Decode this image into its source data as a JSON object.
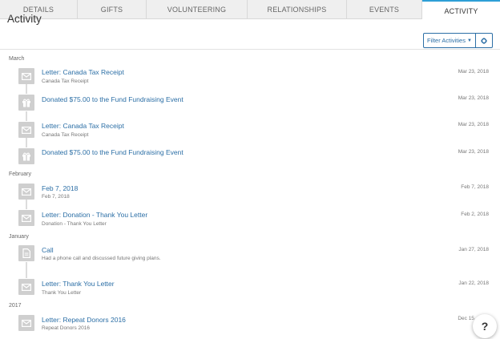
{
  "tabs": [
    {
      "label": "DETAILS"
    },
    {
      "label": "GIFTS"
    },
    {
      "label": "VOLUNTEERING"
    },
    {
      "label": "RELATIONSHIPS"
    },
    {
      "label": "EVENTS"
    },
    {
      "label": "ACTIVITY"
    }
  ],
  "header": {
    "title": "Activity",
    "filter_label": "Filter Activities"
  },
  "groups": [
    {
      "label": "March",
      "items": [
        {
          "icon": "envelope-icon",
          "title": "Letter: Canada Tax Receipt",
          "subtitle": "Canada Tax Receipt",
          "date": "Mar 23, 2018"
        },
        {
          "icon": "gift-icon",
          "title": "Donated $75.00 to the Fund Fundraising Event",
          "subtitle": "",
          "date": "Mar 23, 2018"
        },
        {
          "icon": "envelope-icon",
          "title": "Letter: Canada Tax Receipt",
          "subtitle": "Canada Tax Receipt",
          "date": "Mar 23, 2018"
        },
        {
          "icon": "gift-icon",
          "title": "Donated $75.00 to the Fund Fundraising Event",
          "subtitle": "",
          "date": "Mar 23, 2018"
        }
      ]
    },
    {
      "label": "February",
      "items": [
        {
          "icon": "envelope-icon",
          "title": "Feb 7, 2018",
          "subtitle": "Feb 7, 2018",
          "date": "Feb 7, 2018"
        },
        {
          "icon": "envelope-icon",
          "title": "Letter: Donation - Thank You Letter",
          "subtitle": "Donation - Thank You Letter",
          "date": "Feb 2, 2018"
        }
      ]
    },
    {
      "label": "January",
      "items": [
        {
          "icon": "document-icon",
          "title": "Call",
          "subtitle": "Had a phone call and discussed future giving plans.",
          "date": "Jan 27, 2018"
        },
        {
          "icon": "envelope-icon",
          "title": "Letter: Thank You Letter",
          "subtitle": "Thank You Letter",
          "date": "Jan 22, 2018"
        }
      ]
    },
    {
      "label": "2017",
      "items": [
        {
          "icon": "envelope-icon",
          "title": "Letter: Repeat Donors 2016",
          "subtitle": "Repeat Donors 2016",
          "date": "Dec 15, 2017"
        }
      ]
    }
  ],
  "help": {
    "label": "?"
  },
  "colors": {
    "accent": "#2e9fd6",
    "link": "#2c6fa6",
    "icon_bg": "#cfcfcf"
  }
}
